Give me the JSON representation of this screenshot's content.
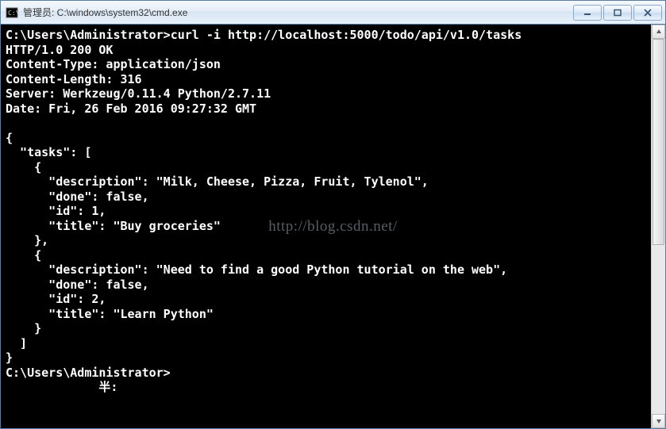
{
  "window": {
    "title": "管理员: C:\\windows\\system32\\cmd.exe"
  },
  "terminal": {
    "prompt1": "C:\\Users\\Administrator>",
    "command": "curl -i http://localhost:5000/todo/api/v1.0/tasks",
    "http_status": "HTTP/1.0 200 OK",
    "headers": [
      "Content-Type: application/json",
      "Content-Length: 316",
      "Server: Werkzeug/0.11.4 Python/2.7.11",
      "Date: Fri, 26 Feb 2016 09:27:32 GMT"
    ],
    "body_open": "{",
    "tasks_key": "  \"tasks\": [",
    "task1": {
      "open": "    {",
      "description": "      \"description\": \"Milk, Cheese, Pizza, Fruit, Tylenol\",",
      "done": "      \"done\": false,",
      "id": "      \"id\": 1,",
      "title": "      \"title\": \"Buy groceries\"",
      "close": "    },"
    },
    "task2": {
      "open": "    {",
      "description": "      \"description\": \"Need to find a good Python tutorial on the web\",",
      "done": "      \"done\": false,",
      "id": "      \"id\": 2,",
      "title": "      \"title\": \"Learn Python\"",
      "close": "    }"
    },
    "tasks_close": "  ]",
    "body_close": "}",
    "prompt2": "C:\\Users\\Administrator>",
    "ime_line": "             半:"
  },
  "watermark": "http://blog.csdn.net/"
}
